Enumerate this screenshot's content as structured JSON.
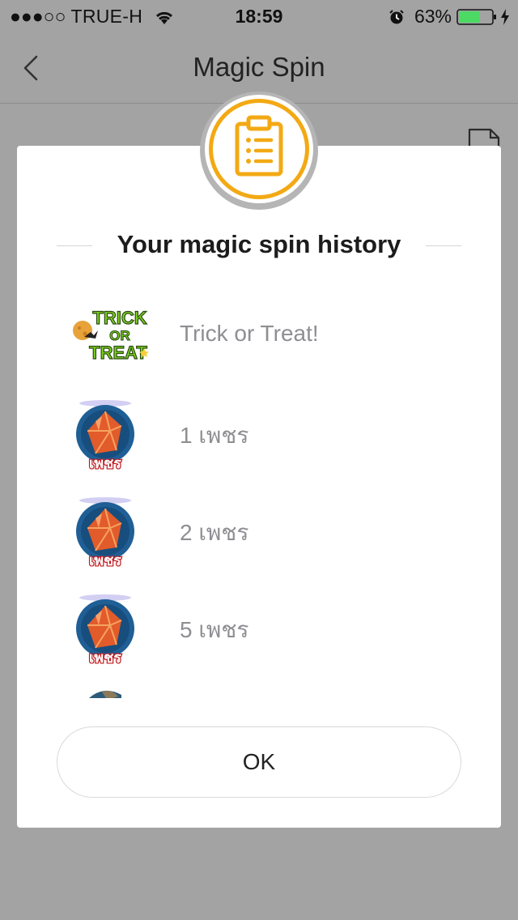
{
  "status_bar": {
    "signal": "●●●○○",
    "carrier": "TRUE-H",
    "time": "18:59",
    "battery": "63%",
    "battery_level": 0.63,
    "battery_color": "#4cd964"
  },
  "nav": {
    "title": "Magic Spin"
  },
  "modal": {
    "accent_color": "#f3a914",
    "heading": "Your magic spin history",
    "items": [
      {
        "icon": "trick-or-treat-icon",
        "label": "Trick or Treat!",
        "badge_text": [
          "TRICK",
          "OR",
          "TREAT"
        ]
      },
      {
        "icon": "gem-icon",
        "label": "1 เพชร",
        "badge_text": "เพชร"
      },
      {
        "icon": "gem-icon",
        "label": "2 เพชร",
        "badge_text": "เพชร"
      },
      {
        "icon": "gem-icon",
        "label": "5 เพชร",
        "badge_text": "เพชร"
      }
    ],
    "ok_label": "OK"
  }
}
